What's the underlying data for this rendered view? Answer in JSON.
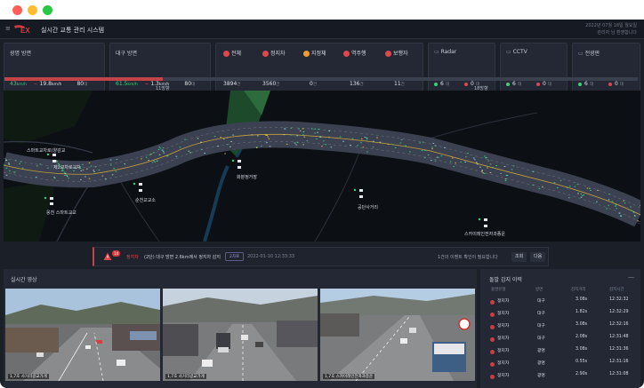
{
  "window": {
    "controls": [
      "#ff5f57",
      "#febc2e",
      "#28c840"
    ]
  },
  "header": {
    "menu_icon": "hamburger-icon",
    "logo_text": "EX",
    "title": "실시간 교통 관리 시스템",
    "right_line1": "2022년 07월 18일 월요일",
    "right_line2": "관리자 님 환영합니다"
  },
  "cards": {
    "speed": {
      "title": "광명 방면",
      "v1": "43",
      "u1": "km/h",
      "delta": "19.8",
      "du": "km/h",
      "count": "80",
      "cu": "대"
    },
    "speed2": {
      "title": "대구 방면",
      "v1": "61.5",
      "u1": "km/h",
      "delta": "1.3",
      "du": "km/h",
      "count": "80",
      "cu": "대"
    },
    "events": [
      {
        "label": "전체",
        "value": "3894",
        "unit": "건",
        "color": "#e0464c"
      },
      {
        "label": "정지차",
        "value": "3560",
        "unit": "건",
        "color": "#e0464c"
      },
      {
        "label": "지정체",
        "value": "0",
        "unit": "건",
        "color": "#f39b2b"
      },
      {
        "label": "역주행",
        "value": "136",
        "unit": "건",
        "color": "#e0464c"
      },
      {
        "label": "보행자",
        "value": "11",
        "unit": "건",
        "color": "#e0464c"
      }
    ],
    "devices": [
      {
        "label": "Radar",
        "on": "6",
        "off": "0",
        "unit": "대"
      },
      {
        "label": "CCTV",
        "on": "6",
        "off": "0",
        "unit": "대"
      },
      {
        "label": "전광판",
        "on": "6",
        "off": "0",
        "unit": "대"
      }
    ]
  },
  "progress": {
    "value": 0.5,
    "left_label": "11방향",
    "right_label": "18방향"
  },
  "map": {
    "labels": [
      "스마트교차로(양감교",
      "제2교차로교차",
      "순천교교소",
      "화분정거장",
      "공단사거리",
      "옹천 스마트교교",
      "스카이레인전자과종운"
    ]
  },
  "alert": {
    "badge": "14",
    "type": "정지차",
    "message": "(2단) 대구 방면 2.6km에서 정지차 감지",
    "tag": "2차로",
    "time": "2022-01-10 12:33:33",
    "more": "1건의 이벤트 확인이 필요합니다",
    "confirm": "조회",
    "next": "다음"
  },
  "live": {
    "title": "실시간 영상",
    "cams": [
      {
        "caption": "1,7호 사거리광교가게"
      },
      {
        "caption": "1,7호 사거리광교가게"
      },
      {
        "caption": "1,7호 스카이레인전자과종운"
      }
    ]
  },
  "events_list": {
    "title": "돌발 감지 이력",
    "columns": [
      "돌발유형",
      "방면",
      "감지거리",
      "감지시간"
    ],
    "rows": [
      {
        "type": "정지차",
        "dir": "대구",
        "dist": "3.08s",
        "time": "12:32:32"
      },
      {
        "type": "정지차",
        "dir": "대구",
        "dist": "1.82s",
        "time": "12:32:29"
      },
      {
        "type": "정지차",
        "dir": "대구",
        "dist": "3.08s",
        "time": "12:32:16"
      },
      {
        "type": "정지차",
        "dir": "대구",
        "dist": "2.08s",
        "time": "12:31:48"
      },
      {
        "type": "정지차",
        "dir": "광명",
        "dist": "3.08s",
        "time": "12:31:36"
      },
      {
        "type": "정지차",
        "dir": "광명",
        "dist": "0.55s",
        "time": "12:31:16"
      },
      {
        "type": "정지차",
        "dir": "광명",
        "dist": "2.90s",
        "time": "12:31:08"
      }
    ]
  }
}
